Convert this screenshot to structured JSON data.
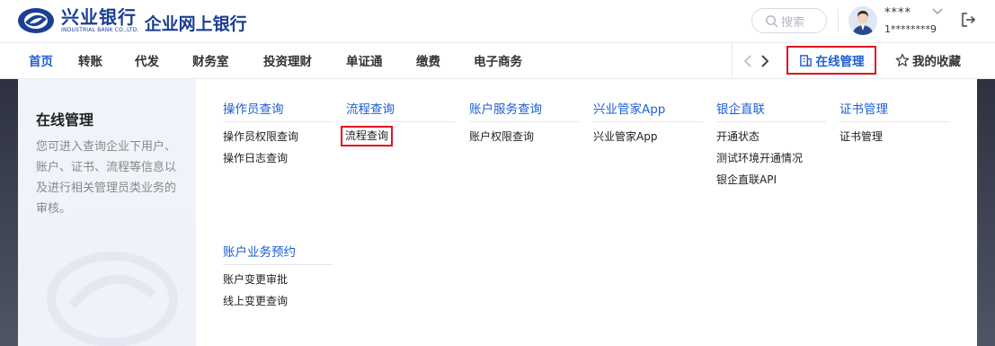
{
  "brand": {
    "name_cn": "兴业银行",
    "name_en": "INDUSTRIAL BANK CO.,LTD.",
    "title": "企业网上银行",
    "brand_color": "#1b3f94"
  },
  "header": {
    "search_placeholder": "搜索",
    "user_name": "****",
    "user_id": "1********9"
  },
  "nav": {
    "items": [
      "首页",
      "转账",
      "代发",
      "财务室",
      "投资理财",
      "单证通",
      "缴费",
      "电子商务"
    ],
    "active_index": 0,
    "online_manage": "在线管理",
    "favorites": "我的收藏",
    "active_color": "#1e5fd1"
  },
  "panel": {
    "title": "在线管理",
    "description": "您可进入查询企业下用户、账户、证书、流程等信息以及进行相关管理员类业务的审核。",
    "columns": [
      {
        "heading": "操作员查询",
        "links": [
          "操作员权限查询",
          "操作日志查询"
        ]
      },
      {
        "heading": "流程查询",
        "links": [
          "流程查询"
        ]
      },
      {
        "heading": "账户服务查询",
        "links": [
          "账户权限查询"
        ]
      },
      {
        "heading": "兴业管家App",
        "links": [
          "兴业管家App"
        ]
      },
      {
        "heading": "银企直联",
        "links": [
          "开通状态",
          "测试环境开通情况",
          "银企直联API"
        ]
      },
      {
        "heading": "证书管理",
        "links": [
          "证书管理"
        ]
      },
      {
        "heading": "账户业务预约",
        "links": [
          "账户变更审批",
          "线上变更查询"
        ]
      }
    ]
  },
  "highlight_color": "#e0151f"
}
